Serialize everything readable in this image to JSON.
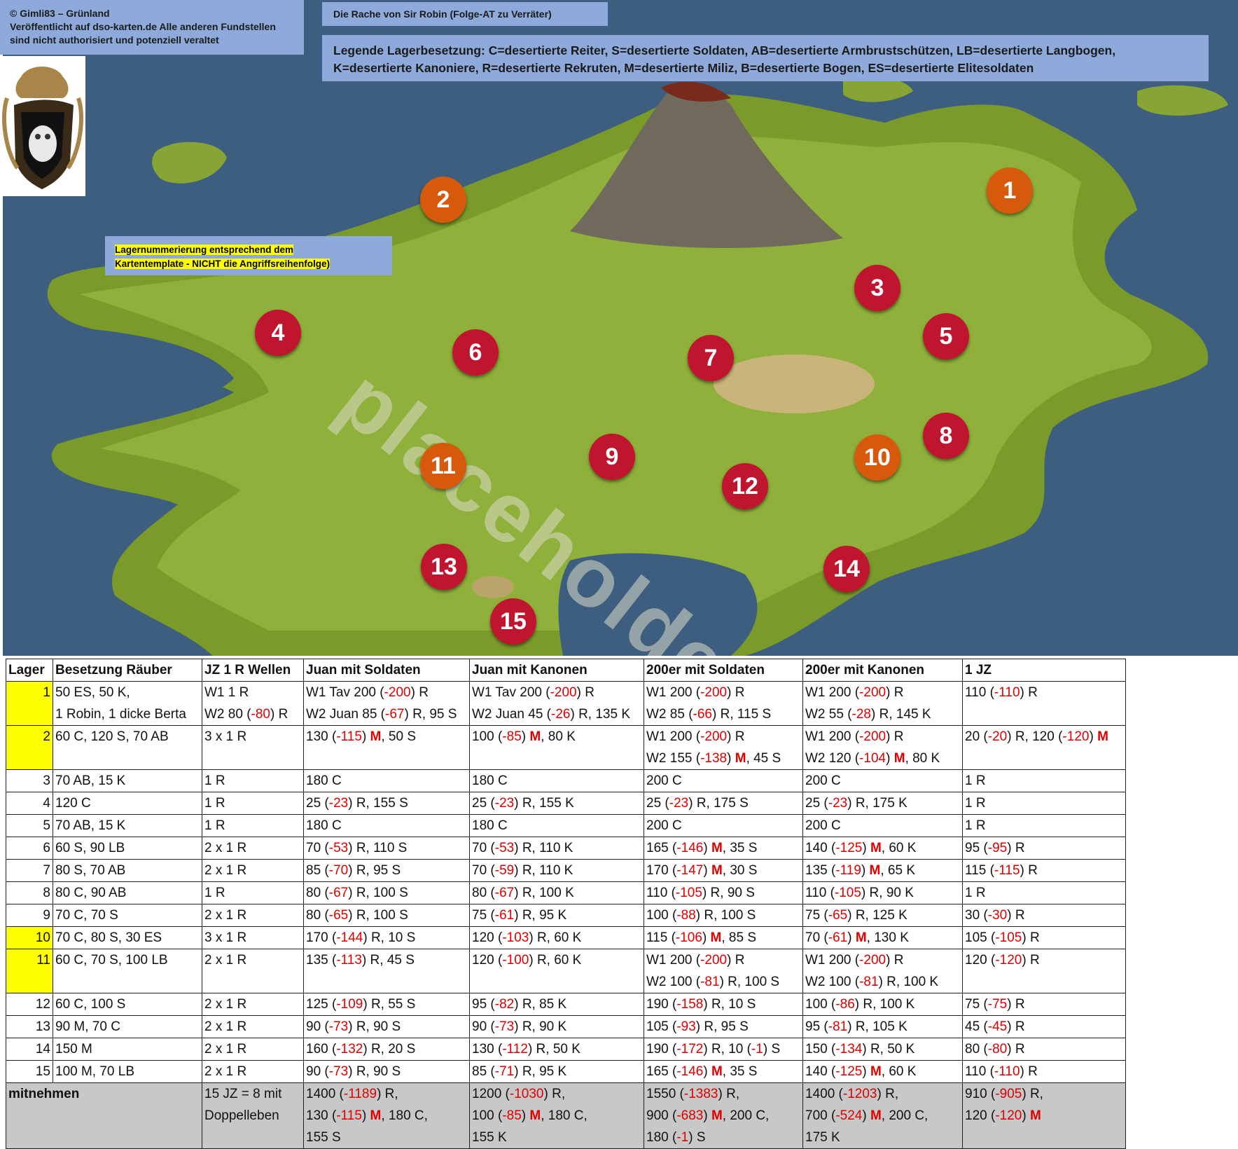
{
  "header": {
    "credit_lines": [
      "© Gimli83 – Grünland",
      "Veröffentlicht auf dso-karten.de Alle anderen Fundstellen",
      "sind nicht authorisiert und potenziell veraltet"
    ],
    "title": "Die Rache von Sir Robin (Folge-AT zu Verräter)",
    "legend_line1": "Legende Lagerbesetzung: C=desertierte Reiter, S=desertierte Soldaten, AB=desertierte Armbrustschützen, LB=desertierte Langbogen,",
    "legend_line2": "K=desertierte Kanoniere, R=desertierte Rekruten, M=desertierte Miliz, B=desertierte Bogen, ES=desertierte Elitesoldaten",
    "note_line1": "Lagernummerierung entsprechend dem",
    "note_line2": "Kartentemplate - NICHT die Angriffsreihenfolge)"
  },
  "watermark": "placeholder",
  "colors": {
    "marker_red": "#c0152f",
    "marker_orange": "#d75a0c",
    "highlight": "#ffff00",
    "negative": "#e00000",
    "infobox": "#8eaadb"
  },
  "markers": [
    {
      "n": "1",
      "color": "orange"
    },
    {
      "n": "2",
      "color": "orange"
    },
    {
      "n": "3",
      "color": "red"
    },
    {
      "n": "4",
      "color": "red"
    },
    {
      "n": "5",
      "color": "red"
    },
    {
      "n": "6",
      "color": "red"
    },
    {
      "n": "7",
      "color": "red"
    },
    {
      "n": "8",
      "color": "red"
    },
    {
      "n": "9",
      "color": "red"
    },
    {
      "n": "10",
      "color": "orange"
    },
    {
      "n": "11",
      "color": "orange"
    },
    {
      "n": "12",
      "color": "red"
    },
    {
      "n": "13",
      "color": "red"
    },
    {
      "n": "14",
      "color": "red"
    },
    {
      "n": "15",
      "color": "red"
    }
  ],
  "table": {
    "headers": [
      "Lager",
      "Besetzung Räuber",
      "JZ 1 R Wellen",
      "Juan mit Soldaten",
      "Juan mit Kanonen",
      "200er mit Soldaten",
      "200er mit Kanonen",
      "1 JZ"
    ],
    "rows": [
      {
        "lager": "1",
        "yellow": true,
        "cells": [
          [
            "50 ES, 50 K,",
            "1 Robin, 1 dicke Berta"
          ],
          [
            "W1 1 R",
            "W2 80 (-80) R"
          ],
          [
            "W1 Tav 200 (-200) R",
            "W2 Juan 85 (-67) R, 95 S"
          ],
          [
            "W1 Tav 200 (-200) R",
            "W2 Juan 45 (-26) R, 135 K"
          ],
          [
            "W1  200 (-200) R",
            "W2  85 (-66) R, 115 S"
          ],
          [
            "W1  200 (-200) R",
            "W2  55 (-28) R, 145 K"
          ],
          [
            "110 (-110) R"
          ]
        ]
      },
      {
        "lager": "2",
        "yellow": true,
        "cells": [
          [
            "60 C, 120 S, 70 AB"
          ],
          [
            "3 x 1 R"
          ],
          [
            "130 (-115) M, 50 S"
          ],
          [
            "100 (-85) M, 80 K"
          ],
          [
            "W1  200 (-200) R",
            "W2  155 (-138) M, 45 S"
          ],
          [
            "W1  200 (-200) R",
            "W2  120 (-104) M, 80 K"
          ],
          [
            "20 (-20) R, 120 (-120) M"
          ]
        ]
      },
      {
        "lager": "3",
        "yellow": false,
        "cells": [
          [
            "70 AB, 15 K"
          ],
          [
            "1 R"
          ],
          [
            "180 C"
          ],
          [
            "180 C"
          ],
          [
            "200 C"
          ],
          [
            "200 C"
          ],
          [
            "1 R"
          ]
        ]
      },
      {
        "lager": "4",
        "yellow": false,
        "cells": [
          [
            "120 C"
          ],
          [
            "1 R"
          ],
          [
            "25 (-23) R, 155 S"
          ],
          [
            "25 (-23) R, 155 K"
          ],
          [
            "25 (-23) R, 175 S"
          ],
          [
            "25 (-23) R, 175 K"
          ],
          [
            "1 R"
          ]
        ]
      },
      {
        "lager": "5",
        "yellow": false,
        "cells": [
          [
            "70 AB, 15 K"
          ],
          [
            "1 R"
          ],
          [
            "180 C"
          ],
          [
            "180 C"
          ],
          [
            "200 C"
          ],
          [
            "200 C"
          ],
          [
            "1 R"
          ]
        ]
      },
      {
        "lager": "6",
        "yellow": false,
        "cells": [
          [
            "60 S, 90 LB"
          ],
          [
            "2 x 1 R"
          ],
          [
            "70 (-53) R, 110 S"
          ],
          [
            "70 (-53) R, 110 K"
          ],
          [
            " 165 (-146) M, 35 S"
          ],
          [
            " 140 (-125) M, 60 K"
          ],
          [
            "95 (-95) R"
          ]
        ]
      },
      {
        "lager": "7",
        "yellow": false,
        "cells": [
          [
            "80 S, 70 AB"
          ],
          [
            "2 x 1 R"
          ],
          [
            "85 (-70) R, 95 S"
          ],
          [
            "70 (-59) R, 110 K"
          ],
          [
            " 170 (-147) M, 30 S"
          ],
          [
            " 135 (-119) M, 65 K"
          ],
          [
            "115 (-115) R"
          ]
        ]
      },
      {
        "lager": "8",
        "yellow": false,
        "cells": [
          [
            "80 C, 90 AB"
          ],
          [
            "1 R"
          ],
          [
            "80 (-67) R, 100 S"
          ],
          [
            "80 (-67) R, 100 K"
          ],
          [
            "110 (-105) R, 90 S"
          ],
          [
            "110 (-105) R, 90 K"
          ],
          [
            "1 R"
          ]
        ]
      },
      {
        "lager": "9",
        "yellow": false,
        "cells": [
          [
            "70 C, 70 S"
          ],
          [
            "2 x 1 R"
          ],
          [
            "80 (-65) R, 100 S"
          ],
          [
            "75 (-61) R, 95 K"
          ],
          [
            "100 (-88) R, 100 S"
          ],
          [
            "75 (-65) R, 125 K"
          ],
          [
            "30 (-30) R"
          ]
        ]
      },
      {
        "lager": "10",
        "yellow": true,
        "cells": [
          [
            "70 C, 80 S, 30 ES"
          ],
          [
            "3 x 1 R"
          ],
          [
            "170 (-144) R, 10 S"
          ],
          [
            "120 (-103) R, 60 K"
          ],
          [
            " 115 (-106) M, 85 S"
          ],
          [
            "70 (-61) M, 130 K"
          ],
          [
            "105 (-105) R"
          ]
        ]
      },
      {
        "lager": "11",
        "yellow": true,
        "cells": [
          [
            "60 C, 70 S, 100 LB"
          ],
          [
            "2 x 1 R"
          ],
          [
            "135 (-113) R, 45 S"
          ],
          [
            "120 (-100) R, 60 K"
          ],
          [
            "W1  200 (-200) R",
            "W2 100 (-81) R, 100 S"
          ],
          [
            "W1  200 (-200) R",
            "W2 100 (-81) R, 100 K"
          ],
          [
            "120 (-120) R"
          ]
        ]
      },
      {
        "lager": "12",
        "yellow": false,
        "cells": [
          [
            "60 C, 100 S"
          ],
          [
            "2 x 1 R"
          ],
          [
            "125 (-109) R, 55 S"
          ],
          [
            "95 (-82) R, 85 K"
          ],
          [
            "190 (-158) R, 10 S"
          ],
          [
            "100 (-86) R, 100 K"
          ],
          [
            "75 (-75) R"
          ]
        ]
      },
      {
        "lager": "13",
        "yellow": false,
        "cells": [
          [
            "90 M, 70 C"
          ],
          [
            "2 x 1 R"
          ],
          [
            "90 (-73) R, 90 S"
          ],
          [
            "90 (-73) R, 90 K"
          ],
          [
            "105 (-93) R, 95 S"
          ],
          [
            "95 (-81) R, 105 K"
          ],
          [
            "45 (-45) R"
          ]
        ]
      },
      {
        "lager": "14",
        "yellow": false,
        "cells": [
          [
            "150 M"
          ],
          [
            "2 x 1 R"
          ],
          [
            "160 (-132) R, 20 S"
          ],
          [
            "130 (-112) R, 50 K"
          ],
          [
            "190 (-172) R, 10 (-1) S"
          ],
          [
            "150 (-134) R, 50 K"
          ],
          [
            "80 (-80) R"
          ]
        ]
      },
      {
        "lager": "15",
        "yellow": false,
        "cells": [
          [
            "100 M, 70 LB"
          ],
          [
            "2 x 1 R"
          ],
          [
            "90 (-73) R, 90 S"
          ],
          [
            "85 (-71) R, 95 K"
          ],
          [
            " 165 (-146) M, 35 S"
          ],
          [
            "140 (-125) M, 60 K"
          ],
          [
            "110 (-110) R"
          ]
        ]
      }
    ],
    "total": {
      "label": "mitnehmen",
      "cells": [
        [
          "15 JZ = 8 mit",
          "Doppelleben"
        ],
        [
          "1400 (-1189) R,",
          "130 (-115) M, 180 C,",
          "155  S"
        ],
        [
          "1200 (-1030) R,",
          "100 (-85) M, 180 C,",
          "155 K"
        ],
        [
          "1550 (-1383) R,",
          "900 (-683) M, 200 C,",
          "180 (-1) S"
        ],
        [
          "1400 (-1203) R,",
          "700 (-524) M, 200 C,",
          "175 K"
        ],
        [
          "910 (-905) R,",
          "120 (-120) M"
        ]
      ]
    }
  }
}
